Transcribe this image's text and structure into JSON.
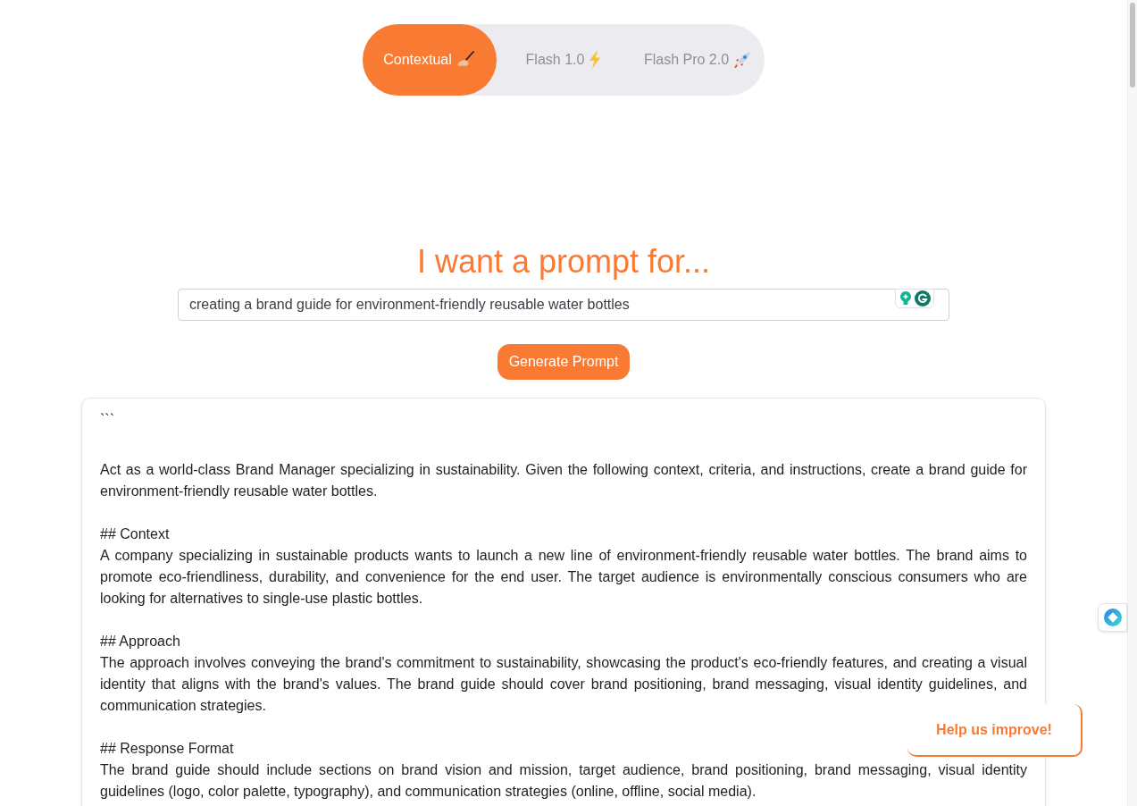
{
  "mode_tabs": [
    {
      "label": "Contextual",
      "selected": true
    },
    {
      "label": "Flash 1.0",
      "selected": false
    },
    {
      "label": "Flash Pro 2.0",
      "selected": false
    }
  ],
  "heading": "I want a prompt for...",
  "prompt_field": {
    "value": "creating a brand guide for environment-friendly reusable water bottles"
  },
  "generate_button": "Generate Prompt",
  "output": {
    "fence": "```",
    "intro": "Act as a world-class Brand Manager specializing in sustainability. Given the following context, criteria, and instructions, create a brand guide for environment-friendly reusable water bottles.",
    "sections": [
      {
        "heading": "## Context",
        "text": "A company specializing in sustainable products wants to launch a new line of environment-friendly reusable water bottles. The brand aims to promote eco-friendliness, durability, and convenience for the end user. The target audience is environmentally conscious consumers who are looking for alternatives to single-use plastic bottles."
      },
      {
        "heading": "## Approach",
        "text": "The approach involves conveying the brand's commitment to sustainability, showcasing the product's eco-friendly features, and creating a visual identity that aligns with the brand's values. The brand guide should cover brand positioning, brand messaging, visual identity guidelines, and communication strategies."
      },
      {
        "heading": "## Response Format",
        "text": "The brand guide should include sections on brand vision and mission, target audience, brand positioning, brand messaging, visual identity guidelines (logo, color palette, typography), and communication strategies (online, offline, social media)."
      }
    ]
  },
  "feedback_button": "Help us improve!"
}
